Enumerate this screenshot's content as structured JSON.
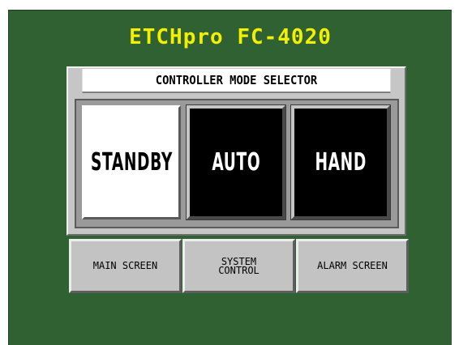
{
  "header": {
    "title": "ETCHpro FC-4020"
  },
  "panel": {
    "title": "CONTROLLER MODE SELECTOR",
    "modes": [
      {
        "label": "STANDBY",
        "state": "selected"
      },
      {
        "label": "AUTO",
        "state": "unselected"
      },
      {
        "label": "HAND",
        "state": "unselected"
      }
    ]
  },
  "nav": {
    "main_screen": "MAIN SCREEN",
    "system_control": "SYSTEM\nCONTROL",
    "alarm_screen": "ALARM SCREEN"
  },
  "colors": {
    "background": "#2f6133",
    "title": "#f2f000",
    "panel": "#c6c6c6"
  }
}
